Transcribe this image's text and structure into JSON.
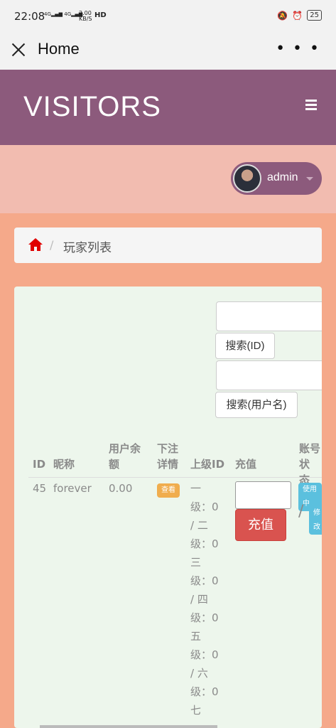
{
  "status_bar": {
    "time": "22:08",
    "network": "4G",
    "speed_top": "2.00",
    "speed_bottom": "KB/S",
    "hd": "HD",
    "battery": "25"
  },
  "app_bar": {
    "title": "Home"
  },
  "brand": {
    "title": "VISITORS"
  },
  "user": {
    "name": "admin"
  },
  "breadcrumb": {
    "separator": "/",
    "label": "玩家列表"
  },
  "search": {
    "id_value": "",
    "id_button": "搜索(ID)",
    "username_value": "",
    "username_button": "搜索(用户名)"
  },
  "table": {
    "headers": {
      "id": "ID",
      "nickname": "昵称",
      "balance_1": "用户余",
      "balance_2": "额",
      "bets_1": "下注",
      "bets_2": "详情",
      "parent": "上级ID",
      "recharge": "充值",
      "account_1": "账号状",
      "account_2": "态"
    },
    "rows": [
      {
        "id": "45",
        "nickname": "forever",
        "balance": "0.00",
        "view_label": "查看",
        "parent_lines": [
          "一",
          "级：0",
          "/ 二",
          "级：0",
          "三",
          "级：0",
          "/ 四",
          "级：0",
          "五",
          "级：0",
          "/ 六",
          "级：0",
          "七"
        ],
        "recharge_value": "",
        "recharge_button": "充值",
        "status_badge": "使用中",
        "separator": "/",
        "edit_label": "修改"
      }
    ]
  },
  "colors": {
    "brand": "#8c5a7c",
    "page_bg": "#f5a98a",
    "user_bar": "#f2bcb0",
    "panel": "#edf6ec",
    "danger": "#d9534f",
    "warning": "#f0ad4e",
    "info": "#5bc0de"
  }
}
